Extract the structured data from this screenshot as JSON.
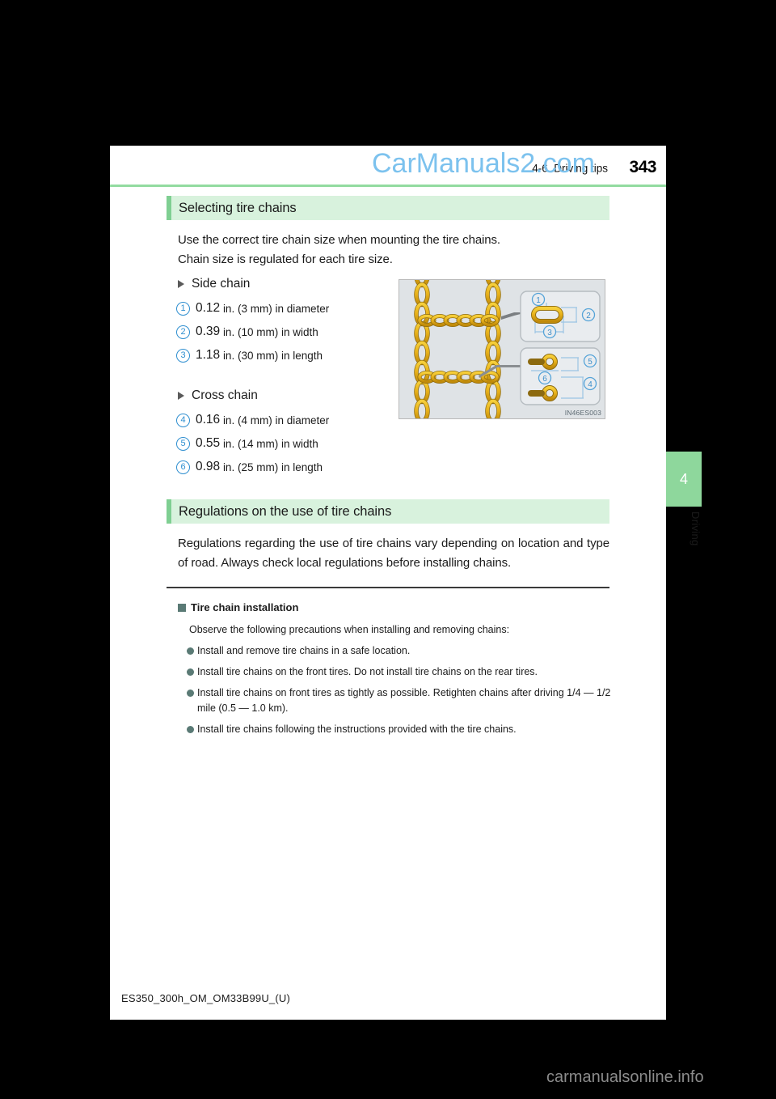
{
  "watermarks": {
    "top": "CarManuals2.com",
    "bottom": "carmanualsonline.info"
  },
  "header": {
    "chapter": "4-6. Driving tips",
    "page_number": "343",
    "accent_color": "#92dba0"
  },
  "sections": [
    {
      "title": "Selecting tire chains",
      "intro_line1": "Use the correct tire chain size when mounting the tire chains.",
      "intro_line2": "Chain size is regulated for each tire size.",
      "groups": [
        {
          "label": "Side chain",
          "items": [
            {
              "num": "1",
              "value": "0.12",
              "unit": "in. (3 mm)",
              "desc": "in diameter"
            },
            {
              "num": "2",
              "value": "0.39",
              "unit": "in. (10 mm)",
              "desc": "in width"
            },
            {
              "num": "3",
              "value": "1.18",
              "unit": "in. (30 mm)",
              "desc": "in length"
            }
          ]
        },
        {
          "label": "Cross chain",
          "items": [
            {
              "num": "4",
              "value": "0.16",
              "unit": "in. (4 mm)",
              "desc": "in diameter"
            },
            {
              "num": "5",
              "value": "0.55",
              "unit": "in. (14 mm)",
              "desc": "in width"
            },
            {
              "num": "6",
              "value": "0.98",
              "unit": "in. (25 mm)",
              "desc": "in length"
            }
          ]
        }
      ],
      "figure": {
        "code": "IN46ES003",
        "callouts": [
          "1",
          "2",
          "3",
          "4",
          "5",
          "6"
        ]
      }
    },
    {
      "title": "Regulations on the use of tire chains",
      "body": "Regulations regarding the use of tire chains vary depending on location and type of road. Always check local regulations before installing chains."
    }
  ],
  "note": {
    "heading": "Tire chain installation",
    "intro": "Observe the following precautions when installing and removing chains:",
    "bullets": [
      "Install and remove tire chains in a safe location.",
      "Install tire chains on the front tires. Do not install tire chains on the rear tires.",
      "Install tire chains on front tires as tightly as possible. Retighten chains after driving 1/4 — 1/2 mile (0.5 — 1.0 km).",
      "Install tire chains following the instructions provided with the tire chains."
    ]
  },
  "side_tab": {
    "number": "4",
    "label": "Driving",
    "color": "#8ed79c"
  },
  "footer": {
    "document_code": "ES350_300h_OM_OM33B99U_(U)"
  }
}
